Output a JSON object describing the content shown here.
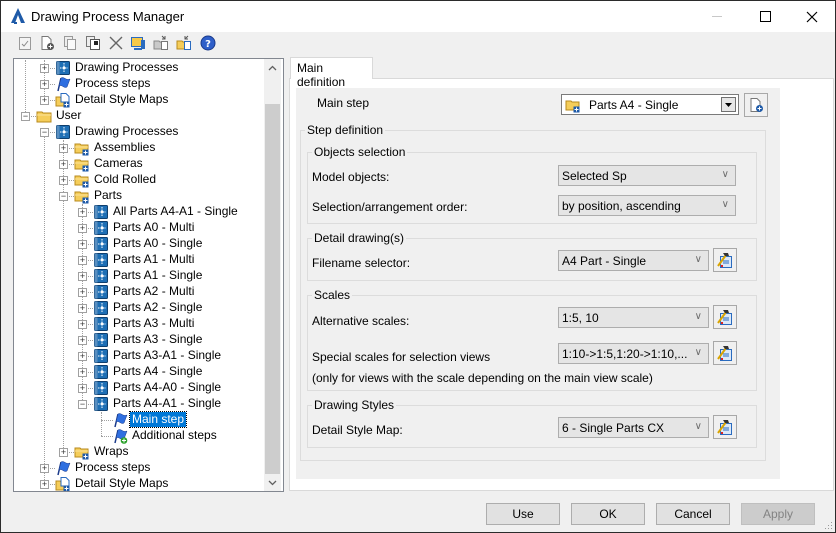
{
  "window": {
    "title": "Drawing Process Manager",
    "controls": [
      "minimize",
      "maximize",
      "close"
    ]
  },
  "toolbar": {
    "icons": [
      "check-document-icon",
      "new-document-icon",
      "copy-icon",
      "paste-icon",
      "delete-icon",
      "monitor-icon",
      "export-icon",
      "import-icon",
      "help-icon"
    ]
  },
  "tree": {
    "items": [
      {
        "label": "Drawing Processes",
        "level": 1,
        "icon": "process-icon",
        "expander": "+"
      },
      {
        "label": "Process steps",
        "level": 1,
        "icon": "flag-icon",
        "expander": "+"
      },
      {
        "label": "Detail Style Maps",
        "level": 1,
        "icon": "style-map-icon",
        "expander": "+"
      },
      {
        "label": "User",
        "level": 0,
        "icon": "folder-icon",
        "expander": "-"
      },
      {
        "label": "Drawing Processes",
        "level": 1,
        "icon": "process-icon",
        "expander": "-"
      },
      {
        "label": "Assemblies",
        "level": 2,
        "icon": "folder-plus-icon",
        "expander": "+"
      },
      {
        "label": "Cameras",
        "level": 2,
        "icon": "folder-plus-icon",
        "expander": "+"
      },
      {
        "label": "Cold Rolled",
        "level": 2,
        "icon": "folder-plus-icon",
        "expander": "+"
      },
      {
        "label": "Parts",
        "level": 2,
        "icon": "folder-plus-icon",
        "expander": "-"
      },
      {
        "label": "All Parts A4-A1 - Single",
        "level": 3,
        "icon": "process-icon",
        "expander": "+"
      },
      {
        "label": "Parts A0 - Multi",
        "level": 3,
        "icon": "process-icon",
        "expander": "+"
      },
      {
        "label": "Parts A0 - Single",
        "level": 3,
        "icon": "process-icon",
        "expander": "+"
      },
      {
        "label": "Parts A1 - Multi",
        "level": 3,
        "icon": "process-icon",
        "expander": "+"
      },
      {
        "label": "Parts A1 - Single",
        "level": 3,
        "icon": "process-icon",
        "expander": "+"
      },
      {
        "label": "Parts A2 - Multi",
        "level": 3,
        "icon": "process-icon",
        "expander": "+"
      },
      {
        "label": "Parts A2 - Single",
        "level": 3,
        "icon": "process-icon",
        "expander": "+"
      },
      {
        "label": "Parts A3 - Multi",
        "level": 3,
        "icon": "process-icon",
        "expander": "+"
      },
      {
        "label": "Parts A3 - Single",
        "level": 3,
        "icon": "process-icon",
        "expander": "+"
      },
      {
        "label": "Parts A3-A1 - Single",
        "level": 3,
        "icon": "process-icon",
        "expander": "+"
      },
      {
        "label": "Parts A4 - Single",
        "level": 3,
        "icon": "process-icon",
        "expander": "+"
      },
      {
        "label": "Parts A4-A0 - Single",
        "level": 3,
        "icon": "process-icon",
        "expander": "+"
      },
      {
        "label": "Parts A4-A1 - Single",
        "level": 3,
        "icon": "process-icon",
        "expander": "-"
      },
      {
        "label": "Main step",
        "level": 4,
        "icon": "flag-icon",
        "expander": "",
        "selected": true
      },
      {
        "label": "Additional steps",
        "level": 4,
        "icon": "flag-add-icon",
        "expander": ""
      },
      {
        "label": "Wraps",
        "level": 2,
        "icon": "folder-plus-icon",
        "expander": "+"
      },
      {
        "label": "Process steps",
        "level": 1,
        "icon": "flag-icon",
        "expander": "+"
      },
      {
        "label": "Detail Style Maps",
        "level": 1,
        "icon": "style-map-icon",
        "expander": "+"
      }
    ]
  },
  "tabs": [
    {
      "label": "Main definition",
      "active": true
    }
  ],
  "main": {
    "main_step_label": "Main step",
    "main_step_value": "Parts A4 - Single",
    "step_definition_title": "Step definition",
    "objects_selection": {
      "title": "Objects selection",
      "model_objects_label": "Model objects:",
      "model_objects_value": "Selected Sp",
      "order_label": "Selection/arrangement order:",
      "order_value": "by position, ascending"
    },
    "detail_drawings": {
      "title": "Detail drawing(s)",
      "filename_label": "Filename selector:",
      "filename_value": "A4 Part - Single"
    },
    "scales": {
      "title": "Scales",
      "alt_label": "Alternative scales:",
      "alt_value": "1:5, 10",
      "special_label": "Special scales for selection views",
      "special_value": "1:10->1:5,1:20->1:10,...",
      "note": "(only for views with the scale depending on the main view scale)"
    },
    "drawing_styles": {
      "title": "Drawing Styles",
      "map_label": "Detail Style Map:",
      "map_value": "6 - Single Parts CX"
    }
  },
  "buttons": {
    "use": "Use",
    "ok": "OK",
    "cancel": "Cancel",
    "apply": "Apply"
  }
}
